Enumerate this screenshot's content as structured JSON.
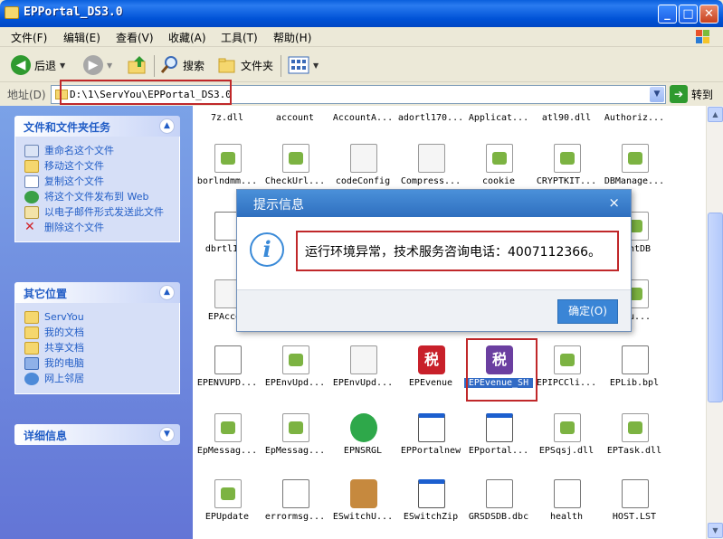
{
  "window": {
    "title": "EPPortal_DS3.0",
    "min": "_",
    "max": "□",
    "close": "✕"
  },
  "menu": [
    "文件(F)",
    "编辑(E)",
    "查看(V)",
    "收藏(A)",
    "工具(T)",
    "帮助(H)"
  ],
  "toolbar": {
    "back": "后退",
    "search": "搜索",
    "folders": "文件夹"
  },
  "address": {
    "label": "地址(D)",
    "value": "D:\\1\\ServYou\\EPPortal_DS3.0",
    "go": "转到"
  },
  "tasks_panel": {
    "title": "文件和文件夹任务",
    "items": [
      "重命名这个文件",
      "移动这个文件",
      "复制这个文件",
      "将这个文件发布到 Web",
      "以电子邮件形式发送此文件",
      "删除这个文件"
    ]
  },
  "places_panel": {
    "title": "其它位置",
    "items": [
      "ServYou",
      "我的文档",
      "共享文档",
      "我的电脑",
      "网上邻居"
    ]
  },
  "details_panel": {
    "title": "详细信息"
  },
  "files": [
    [
      "7z.dll",
      "account",
      "AccountA...",
      "adortl170...",
      "Applicat...",
      "atl90.dll",
      "Authoriz..."
    ],
    [
      "borlndmm...",
      "CheckUrl...",
      "codeConfig",
      "Compress...",
      "cookie",
      "CRYPTKIT...",
      "DBManage..."
    ],
    [
      "dbrtl170",
      "",
      "",
      "",
      "",
      "",
      "ountDB"
    ],
    [
      "EPAccou",
      "",
      "",
      "",
      "",
      "",
      "Plu..."
    ],
    [
      "EPENVUPD...",
      "EPEnvUpd...",
      "EPEnvUpd...",
      "EPEvenue",
      "EPEvenue_SH",
      "EPIPCCli...",
      "EPLib.bpl"
    ],
    [
      "EpMessag...",
      "EpMessag...",
      "EPNSRGL",
      "EPPortalnew",
      "EPportal...",
      "EPSqsj.dll",
      "EPTask.dll"
    ],
    [
      "EPUpdate",
      "errormsg...",
      "ESwitchU...",
      "ESwitchZip",
      "GRSDSDB.dbc",
      "health",
      "HOST.LST"
    ]
  ],
  "dialog": {
    "title": "提示信息",
    "message": "运行环境异常，技术服务咨询电话：4007112366。",
    "ok": "确定(O)",
    "close": "×",
    "info_glyph": "i"
  },
  "icons": {
    "tax_glyph": "税"
  }
}
